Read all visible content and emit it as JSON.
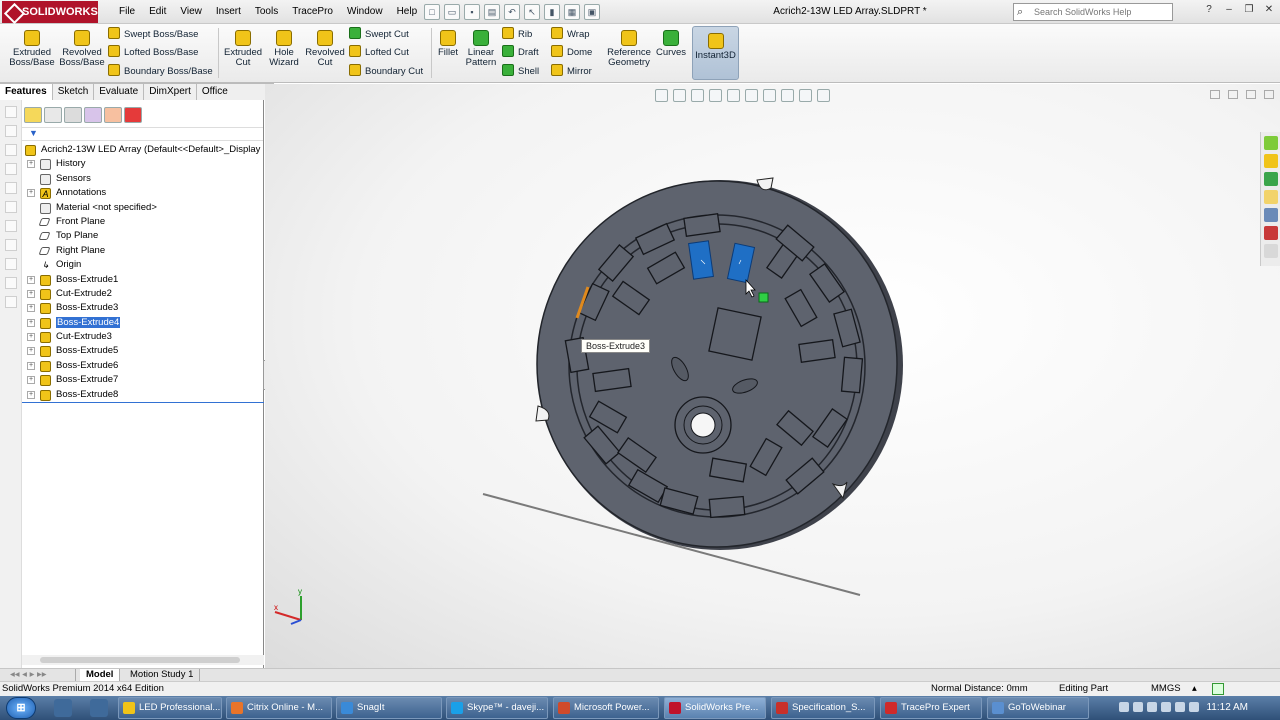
{
  "app": {
    "logo": "SOLIDWORKS",
    "document_title": "Acrich2-13W LED Array.SLDPRT *"
  },
  "menu": [
    "File",
    "Edit",
    "View",
    "Insert",
    "Tools",
    "TracePro",
    "Window",
    "Help"
  ],
  "search": {
    "placeholder": "Search SolidWorks Help"
  },
  "toolbar": {
    "extruded_boss": "Extruded Boss/Base",
    "revolved_boss": "Revolved Boss/Base",
    "swept_boss": "Swept Boss/Base",
    "lofted_boss": "Lofted Boss/Base",
    "boundary_boss": "Boundary Boss/Base",
    "extruded_cut": "Extruded Cut",
    "hole_wizard": "Hole Wizard",
    "revolved_cut": "Revolved Cut",
    "swept_cut": "Swept Cut",
    "lofted_cut": "Lofted Cut",
    "boundary_cut": "Boundary Cut",
    "fillet": "Fillet",
    "linear_pattern": "Linear Pattern",
    "rib": "Rib",
    "draft": "Draft",
    "shell": "Shell",
    "wrap": "Wrap",
    "dome": "Dome",
    "mirror": "Mirror",
    "reference_geometry": "Reference Geometry",
    "curves": "Curves",
    "instant3d": "Instant3D"
  },
  "tabs": [
    "Features",
    "Sketch",
    "Evaluate",
    "DimXpert",
    "Office Products"
  ],
  "tree": {
    "root": "Acrich2-13W LED Array  (Default<<Default>_Display",
    "items": [
      "History",
      "Sensors",
      "Annotations",
      "Material <not specified>",
      "Front Plane",
      "Top Plane",
      "Right Plane",
      "Origin",
      "Boss-Extrude1",
      "Cut-Extrude2",
      "Boss-Extrude3",
      "Boss-Extrude4",
      "Cut-Extrude3",
      "Boss-Extrude5",
      "Boss-Extrude6",
      "Boss-Extrude7",
      "Boss-Extrude8"
    ],
    "selected_index": 11
  },
  "viewport": {
    "tooltip": "Boss-Extrude3"
  },
  "bottom_tabs": [
    "Model",
    "Motion Study 1"
  ],
  "status": {
    "edition": "SolidWorks Premium 2014 x64 Edition",
    "distance": "Normal Distance: 0mm",
    "mode": "Editing Part",
    "units": "MMGS"
  },
  "taskbar": {
    "buttons": [
      "LED Professional...",
      "Citrix Online - M...",
      "SnagIt",
      "Skype™ - daveji...",
      "Microsoft Power...",
      "SolidWorks Pre...",
      "Specification_S...",
      "TracePro Expert",
      "GoToWebinar"
    ],
    "clock": "11:12 AM"
  },
  "colors": {
    "accent": "#3271d3",
    "brand": "#b0132a",
    "part_fill": "#5e636e",
    "selected_face": "#1f6fc5"
  }
}
